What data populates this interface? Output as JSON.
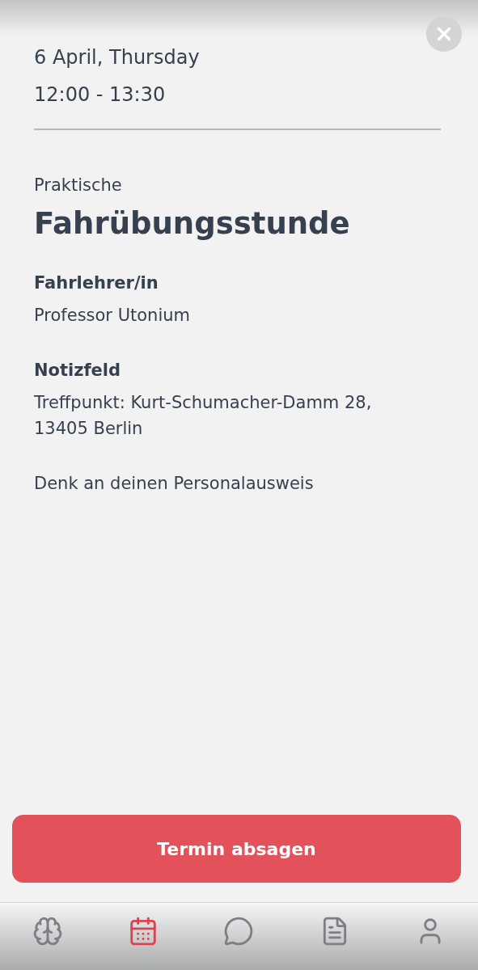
{
  "header": {
    "date": "6 April, Thursday",
    "time": "12:00 - 13:30"
  },
  "title": {
    "prefix": "Praktische",
    "main": "Fahrübungsstunde"
  },
  "sections": [
    {
      "heading": "Fahrlehrer/in",
      "lines": [
        "Professor Utonium"
      ]
    },
    {
      "heading": "Notizfeld",
      "lines": [
        "Treffpunkt: Kurt-Schumacher-Damm 28, 13405 Berlin",
        "Denk an deinen Personalausweis"
      ]
    }
  ],
  "cancel_button": "Termin absagen",
  "nav": [
    {
      "kind": "brain",
      "selected": false
    },
    {
      "kind": "calendar",
      "selected": true
    },
    {
      "kind": "chat",
      "selected": false
    },
    {
      "kind": "document",
      "selected": false
    },
    {
      "kind": "profile",
      "selected": false
    }
  ]
}
